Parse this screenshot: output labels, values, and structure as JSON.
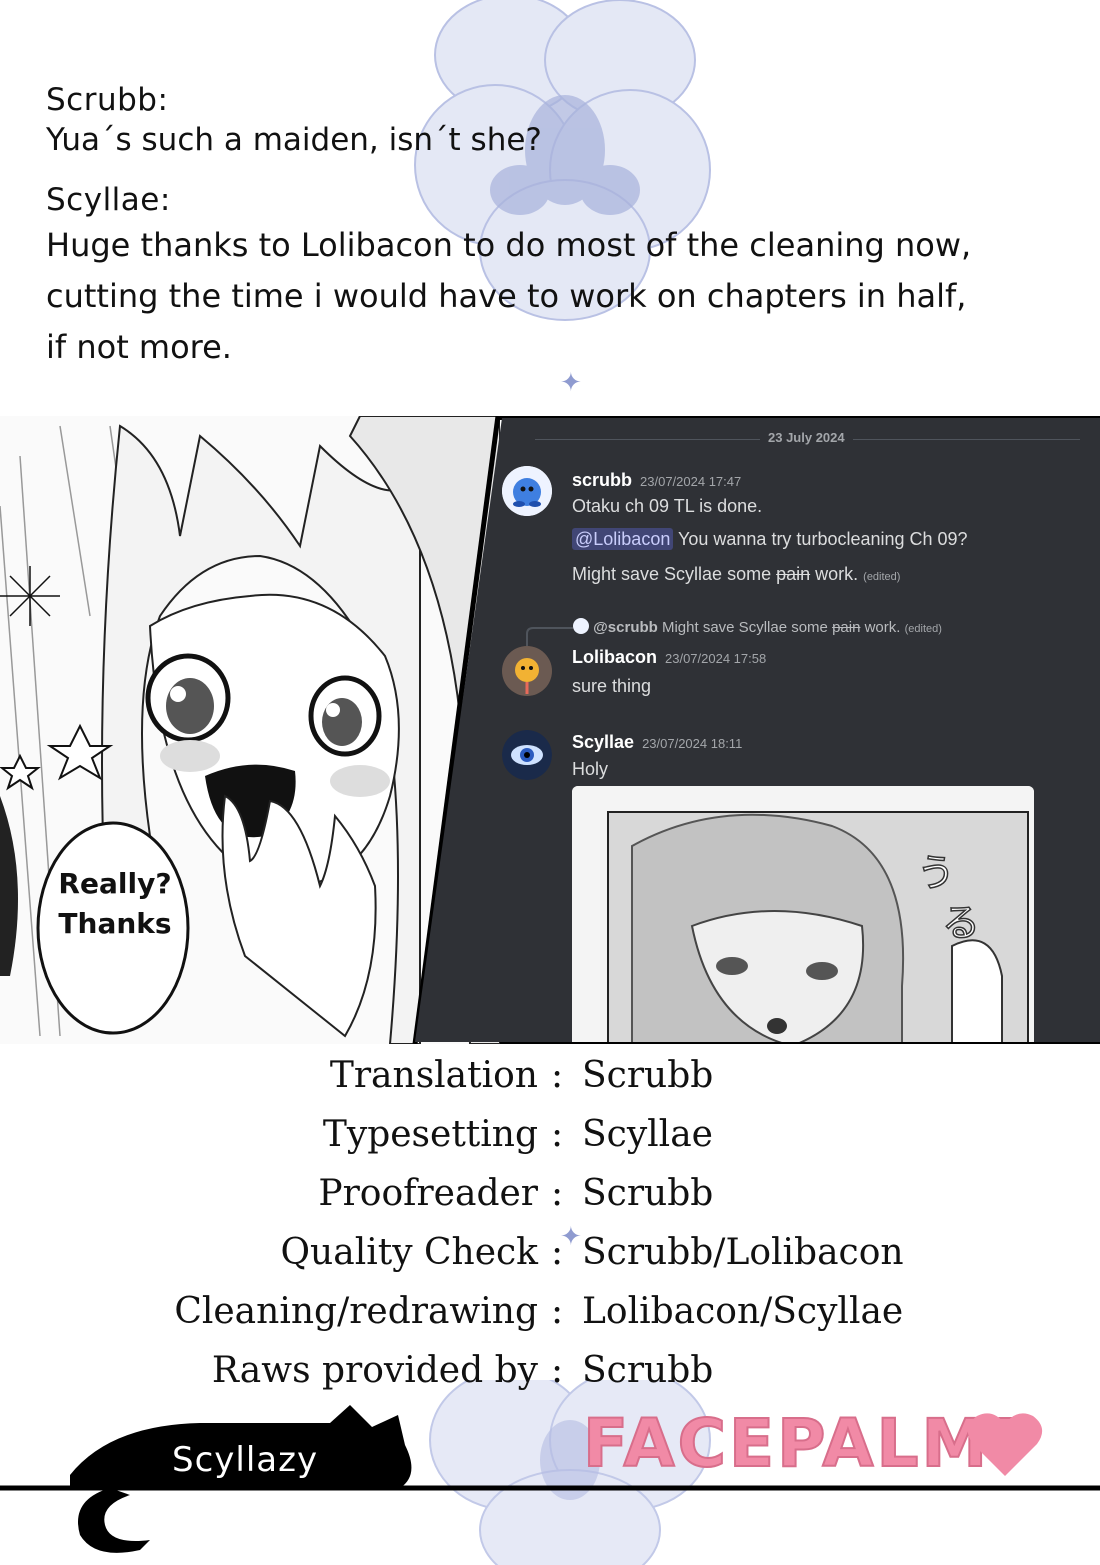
{
  "notes": [
    {
      "speaker": "Scrubb:",
      "lines": [
        "Yua´s such a maiden, isn´t she?"
      ]
    },
    {
      "speaker": "Scyllae:",
      "lines": [
        "Huge thanks to Lolibacon to do most of the cleaning now,",
        "cutting the time i would have to work on chapters in half,",
        "if not more."
      ]
    }
  ],
  "manga": {
    "speech_bubble": [
      "Really?",
      "Thanks"
    ]
  },
  "discord": {
    "date_divider": "23 July 2024",
    "messages": [
      {
        "author": "scrubb",
        "timestamp": "23/07/2024 17:47",
        "line1": "Otaku ch 09 TL is done.",
        "mention": "@Lolibacon",
        "line2_rest": " You wanna try turbocleaning Ch 09?",
        "line3_a": "Might save Scyllae some ",
        "line3_strike": "pain",
        "line3_b": " work.",
        "edited": "(edited)"
      },
      {
        "reply_to": "@scrubb",
        "reply_a": "Might save Scyllae some ",
        "reply_strike": "pain",
        "reply_b": " work.",
        "reply_edited": "(edited)",
        "author": "Lolibacon",
        "timestamp": "23/07/2024 17:58",
        "text": "sure thing"
      },
      {
        "author": "Scyllae",
        "timestamp": "23/07/2024 18:11",
        "text": "Holy"
      }
    ],
    "colors": {
      "background": "#2f3136",
      "mention_bg": "#414675",
      "username": "#ffffff"
    }
  },
  "credits": [
    {
      "role": "Translation",
      "name": "Scrubb"
    },
    {
      "role": "Typesetting",
      "name": "Scyllae"
    },
    {
      "role": "Proofreader",
      "name": "Scrubb"
    },
    {
      "role": "Quality Check",
      "name": "Scrubb/Lolibacon"
    },
    {
      "role": "Cleaning/redrawing",
      "name": "Lolibacon/Scyllae"
    },
    {
      "role": "Raws provided by",
      "name": "Scrubb"
    }
  ],
  "colon": ":",
  "footer": {
    "cat_label": "Scyllazy",
    "logo_text": "FACEPALM!",
    "logo_color": "#f18aa6"
  },
  "icons": [
    "flower-watermark",
    "sparkle-icon",
    "cat-silhouette",
    "heart-icon"
  ]
}
